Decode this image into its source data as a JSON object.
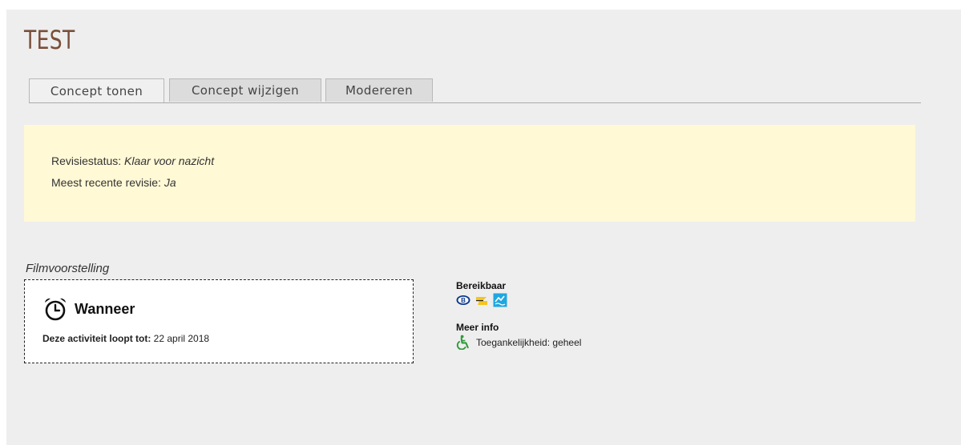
{
  "page": {
    "title": "TEST"
  },
  "tabs": [
    {
      "label": "Concept tonen",
      "active": true
    },
    {
      "label": "Concept wijzigen",
      "active": false
    },
    {
      "label": "Modereren",
      "active": false
    }
  ],
  "status": {
    "revision_status_label": "Revisiestatus: ",
    "revision_status_value": "Klaar voor nazicht",
    "latest_revision_label": "Meest recente revisie: ",
    "latest_revision_value": "Ja"
  },
  "event": {
    "type": "Filmvoorstelling",
    "when_heading": "Wanneer",
    "runs_until_label": "Deze activiteit loopt tot:",
    "runs_until_value": " 22 april 2018"
  },
  "sidebar": {
    "reachable_heading": "Bereikbaar",
    "transport_icons": [
      "nmbs-train-icon",
      "bus-icon",
      "waterbus-icon"
    ],
    "more_info_heading": "Meer info",
    "accessibility_icon": "wheelchair-icon",
    "accessibility_text": "Toegankelijkheid: geheel"
  },
  "colors": {
    "title": "#7b4f3a",
    "status_background": "#fff9d6",
    "page_background": "#eeeeee",
    "accessibility_green": "#2e9b3a",
    "waterbus_blue": "#1ea7e1"
  }
}
